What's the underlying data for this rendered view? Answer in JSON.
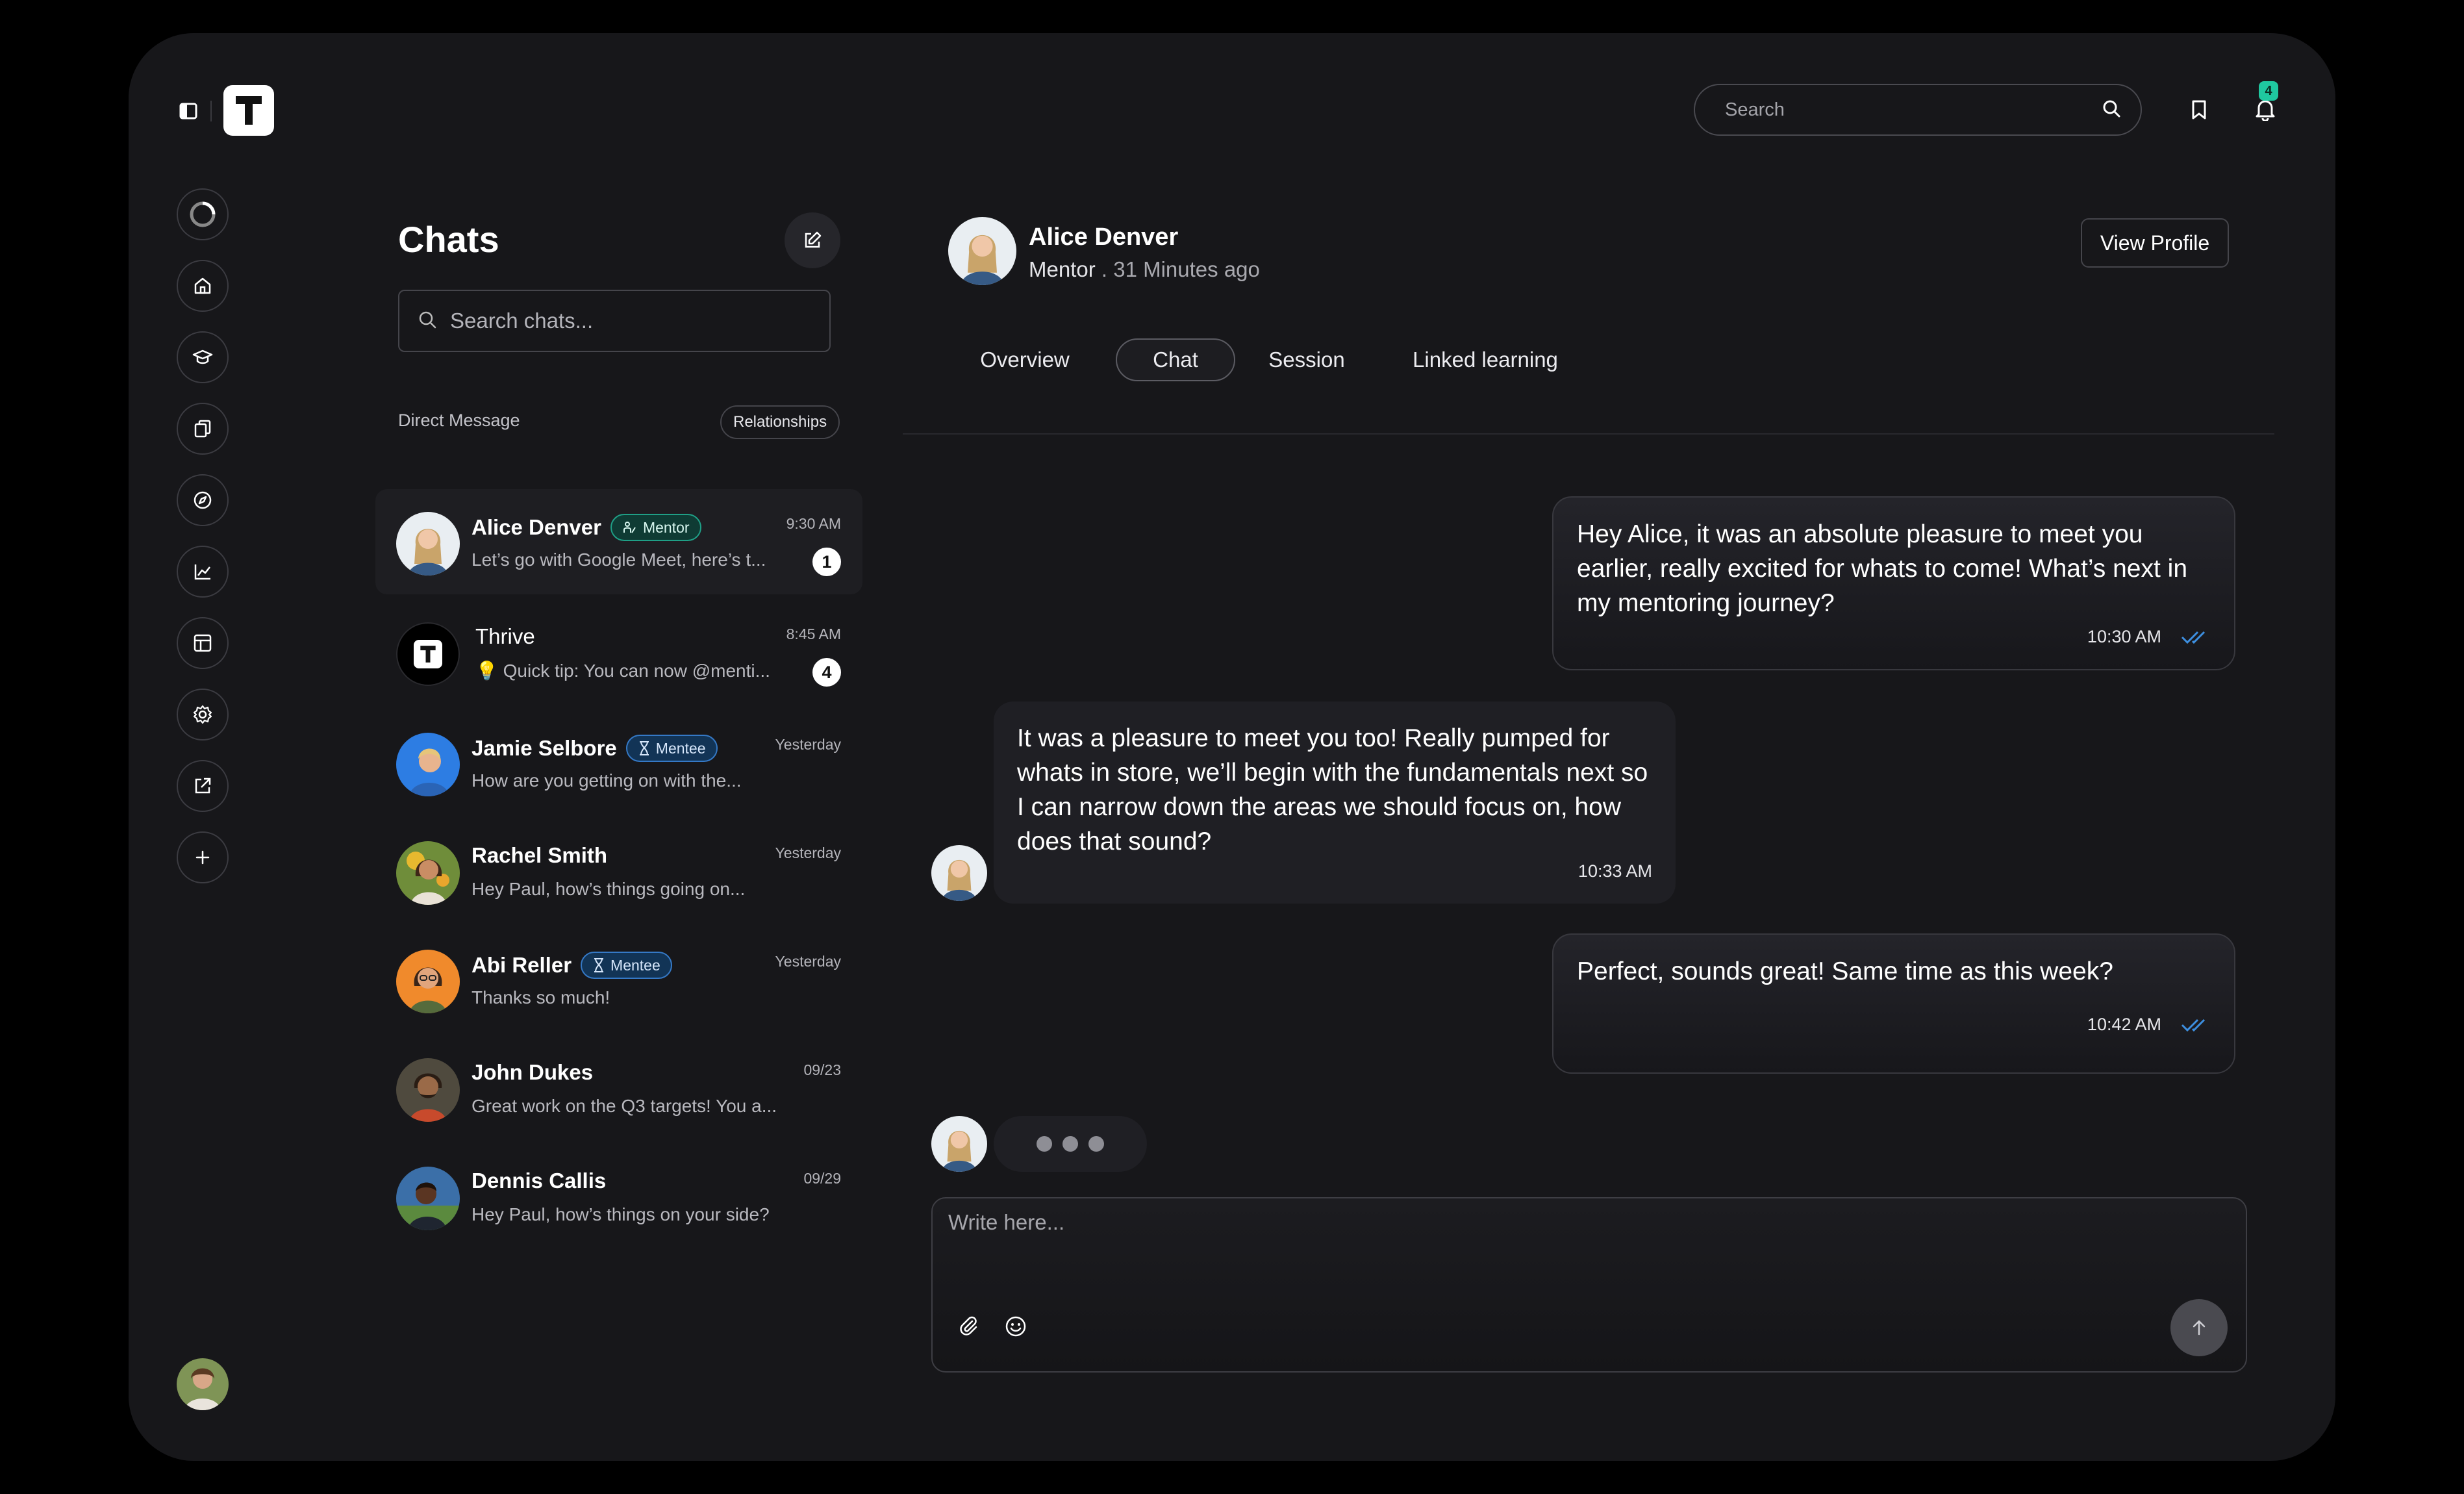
{
  "header": {
    "logo_letter": "T",
    "search_placeholder": "Search",
    "notification_count": "4"
  },
  "rail": {
    "items": [
      "loading-icon",
      "home-icon",
      "graduation-cap-icon",
      "documents-icon",
      "compass-icon",
      "chart-icon",
      "layout-icon",
      "settings-icon",
      "external-link-icon",
      "plus-icon"
    ]
  },
  "chats": {
    "title": "Chats",
    "search_placeholder": "Search chats...",
    "section_label": "Direct Message",
    "relationships_label": "Relationships",
    "items": [
      {
        "name": "Alice Denver",
        "badge": "Mentor",
        "preview": "Let’s go with Google Meet, here’s t...",
        "time": "9:30 AM",
        "unread": "1"
      },
      {
        "name": "Thrive",
        "badge": "",
        "preview": "💡 Quick tip: You can now @menti...",
        "time": "8:45 AM",
        "unread": "4"
      },
      {
        "name": "Jamie Selbore",
        "badge": "Mentee",
        "preview": "How are you getting on with the...",
        "time": "Yesterday",
        "unread": ""
      },
      {
        "name": "Rachel Smith",
        "badge": "",
        "preview": "Hey Paul, how’s things going on...",
        "time": "Yesterday",
        "unread": ""
      },
      {
        "name": "Abi Reller",
        "badge": "Mentee",
        "preview": "Thanks so much!",
        "time": "Yesterday",
        "unread": ""
      },
      {
        "name": "John Dukes",
        "badge": "",
        "preview": "Great work on the Q3 targets! You a...",
        "time": "09/23",
        "unread": ""
      },
      {
        "name": "Dennis Callis",
        "badge": "",
        "preview": "Hey Paul, how’s things on your side?",
        "time": "09/29",
        "unread": ""
      }
    ]
  },
  "conversation": {
    "name": "Alice Denver",
    "role": "Mentor",
    "last_seen": " . 31 Minutes ago",
    "view_profile_label": "View Profile",
    "tabs": [
      "Overview",
      "Chat",
      "Session",
      "Linked learning"
    ],
    "active_tab": "Chat",
    "messages": [
      {
        "direction": "out",
        "text": "Hey Alice, it was an absolute pleasure to meet you earlier, really excited for whats to come! What’s next in my mentoring journey?",
        "time": "10:30 AM"
      },
      {
        "direction": "in",
        "text": "It was a pleasure to meet you too! Really pumped for whats in store, we’ll begin with the fundamentals next so I can narrow down the areas we should focus on, how does that sound?",
        "time": "10:33 AM"
      },
      {
        "direction": "out",
        "text": "Perfect, sounds great! Same time as this week?",
        "time": "10:42 AM"
      }
    ],
    "composer_placeholder": "Write here..."
  },
  "colors": {
    "background": "#17171a",
    "mentor_badge": "#1f9f86",
    "mentee_badge": "#3579c6",
    "notification_badge": "#1fc8a0",
    "read_tick": "#3d8fe0"
  }
}
